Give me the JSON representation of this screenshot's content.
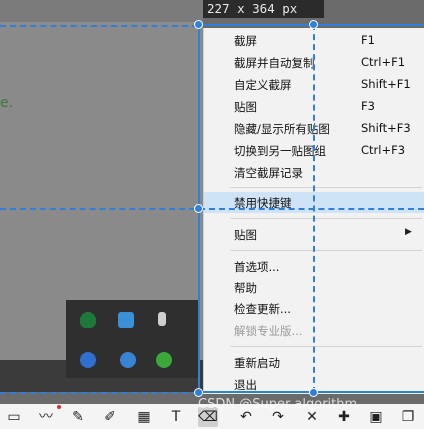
{
  "size_readout": "227 x 364 px",
  "menu": {
    "items": [
      {
        "label": "截屏",
        "shortcut": "F1"
      },
      {
        "label": "截屏并自动复制",
        "shortcut": "Ctrl+F1"
      },
      {
        "label": "自定义截屏",
        "shortcut": "Shift+F1"
      },
      {
        "label": "贴图",
        "shortcut": "F3"
      },
      {
        "label": "隐藏/显示所有贴图",
        "shortcut": "Shift+F3"
      },
      {
        "label": "切换到另一贴图组",
        "shortcut": "Ctrl+F3"
      },
      {
        "label": "清空截屏记录",
        "shortcut": ""
      },
      {
        "label": "禁用快捷键",
        "shortcut": ""
      },
      {
        "label": "贴图",
        "shortcut": ""
      },
      {
        "label": "首选项...",
        "shortcut": ""
      },
      {
        "label": "帮助",
        "shortcut": ""
      },
      {
        "label": "检查更新...",
        "shortcut": ""
      },
      {
        "label": "解锁专业版...",
        "shortcut": ""
      },
      {
        "label": "重新启动",
        "shortcut": ""
      },
      {
        "label": "退出",
        "shortcut": ""
      }
    ]
  },
  "watermark": "CSDN @Super algorithm",
  "background_partial_text": "e.",
  "colors": {
    "selection": "#2f7fdc",
    "highlight": "#cfe3f7",
    "menu_bg": "#f2f2f2",
    "disabled_text": "#9a9a9a"
  },
  "toolbar_icons": [
    "rectangle-icon",
    "line-chart-icon",
    "pen-icon",
    "marker-icon",
    "mosaic-icon",
    "text-icon",
    "eraser-icon",
    "undo-icon",
    "redo-icon",
    "cross-icon",
    "pin-icon",
    "save-icon",
    "copy-icon"
  ]
}
